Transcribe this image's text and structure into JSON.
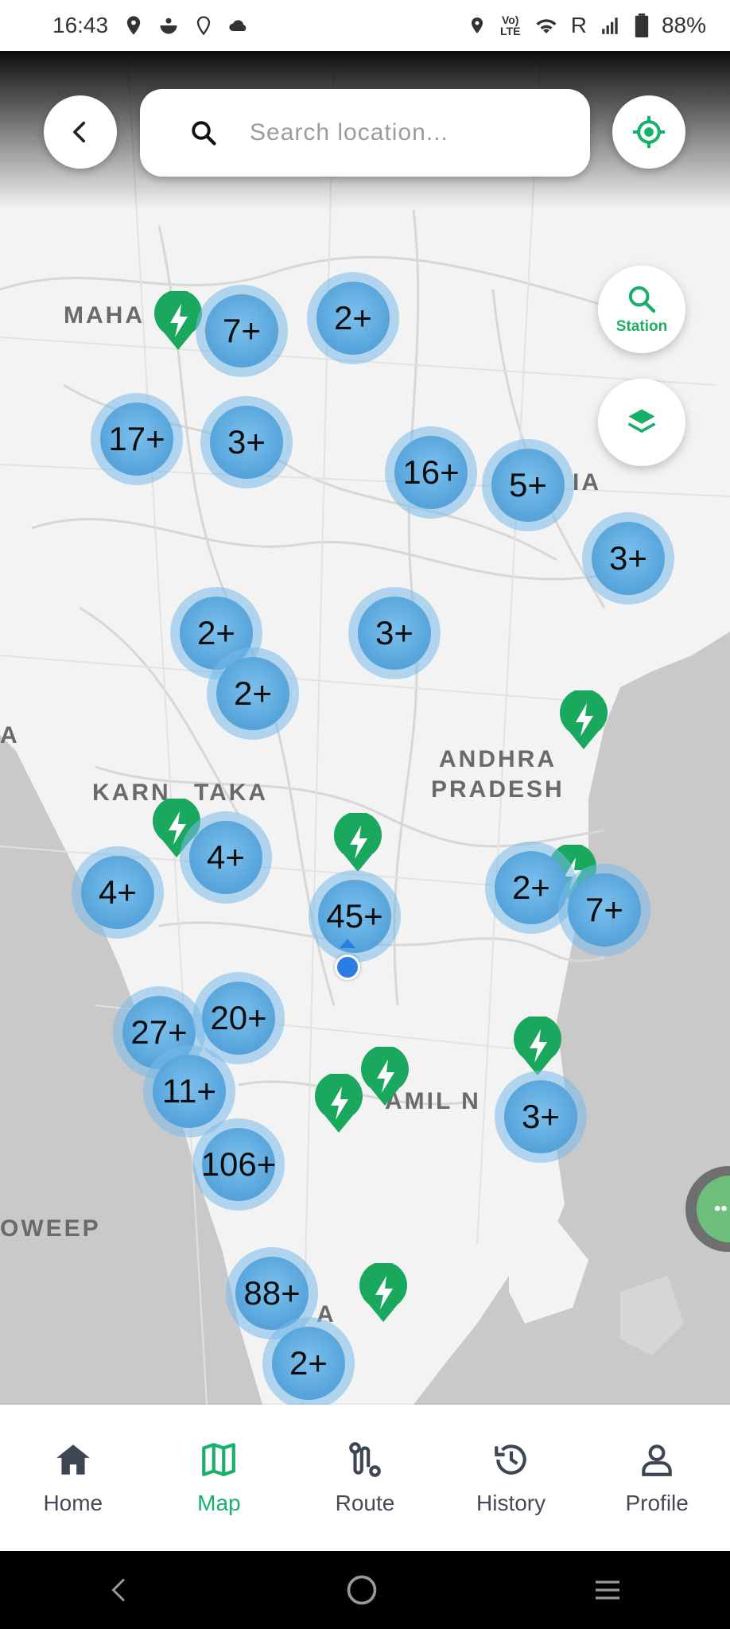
{
  "status_bar": {
    "time": "16:43",
    "carrier_letter": "R",
    "volte": "Vo) LTE",
    "battery": "88%"
  },
  "search": {
    "placeholder": "Search location..."
  },
  "fab": {
    "station_label": "Station"
  },
  "regions": [
    {
      "label": "MAHA"
    },
    {
      "label": "IA"
    },
    {
      "label": "A"
    },
    {
      "label": "KARN"
    },
    {
      "label": "TAKA"
    },
    {
      "label": "ANDHRA"
    },
    {
      "label": "PRADESH"
    },
    {
      "label": "AMIL N"
    },
    {
      "label": "OWEEP"
    },
    {
      "label": "A"
    }
  ],
  "clusters": [
    {
      "count": "7+"
    },
    {
      "count": "2+"
    },
    {
      "count": "17+"
    },
    {
      "count": "3+"
    },
    {
      "count": "16+"
    },
    {
      "count": "5+"
    },
    {
      "count": "3+"
    },
    {
      "count": "2+"
    },
    {
      "count": "3+"
    },
    {
      "count": "2+"
    },
    {
      "count": "4+"
    },
    {
      "count": "4+"
    },
    {
      "count": "45+"
    },
    {
      "count": "2+"
    },
    {
      "count": "7+"
    },
    {
      "count": "27+"
    },
    {
      "count": "20+"
    },
    {
      "count": "11+"
    },
    {
      "count": "3+"
    },
    {
      "count": "106+"
    },
    {
      "count": "88+"
    },
    {
      "count": "2+"
    }
  ],
  "colors": {
    "brand_green": "#17b06a",
    "cluster_blue": "#4f9fd8",
    "user_dot": "#2b7de3"
  },
  "nav": {
    "items": [
      {
        "label": "Home",
        "icon": "home-icon"
      },
      {
        "label": "Map",
        "icon": "map-icon",
        "active": true
      },
      {
        "label": "Route",
        "icon": "route-icon"
      },
      {
        "label": "History",
        "icon": "history-icon"
      },
      {
        "label": "Profile",
        "icon": "profile-icon"
      }
    ]
  }
}
